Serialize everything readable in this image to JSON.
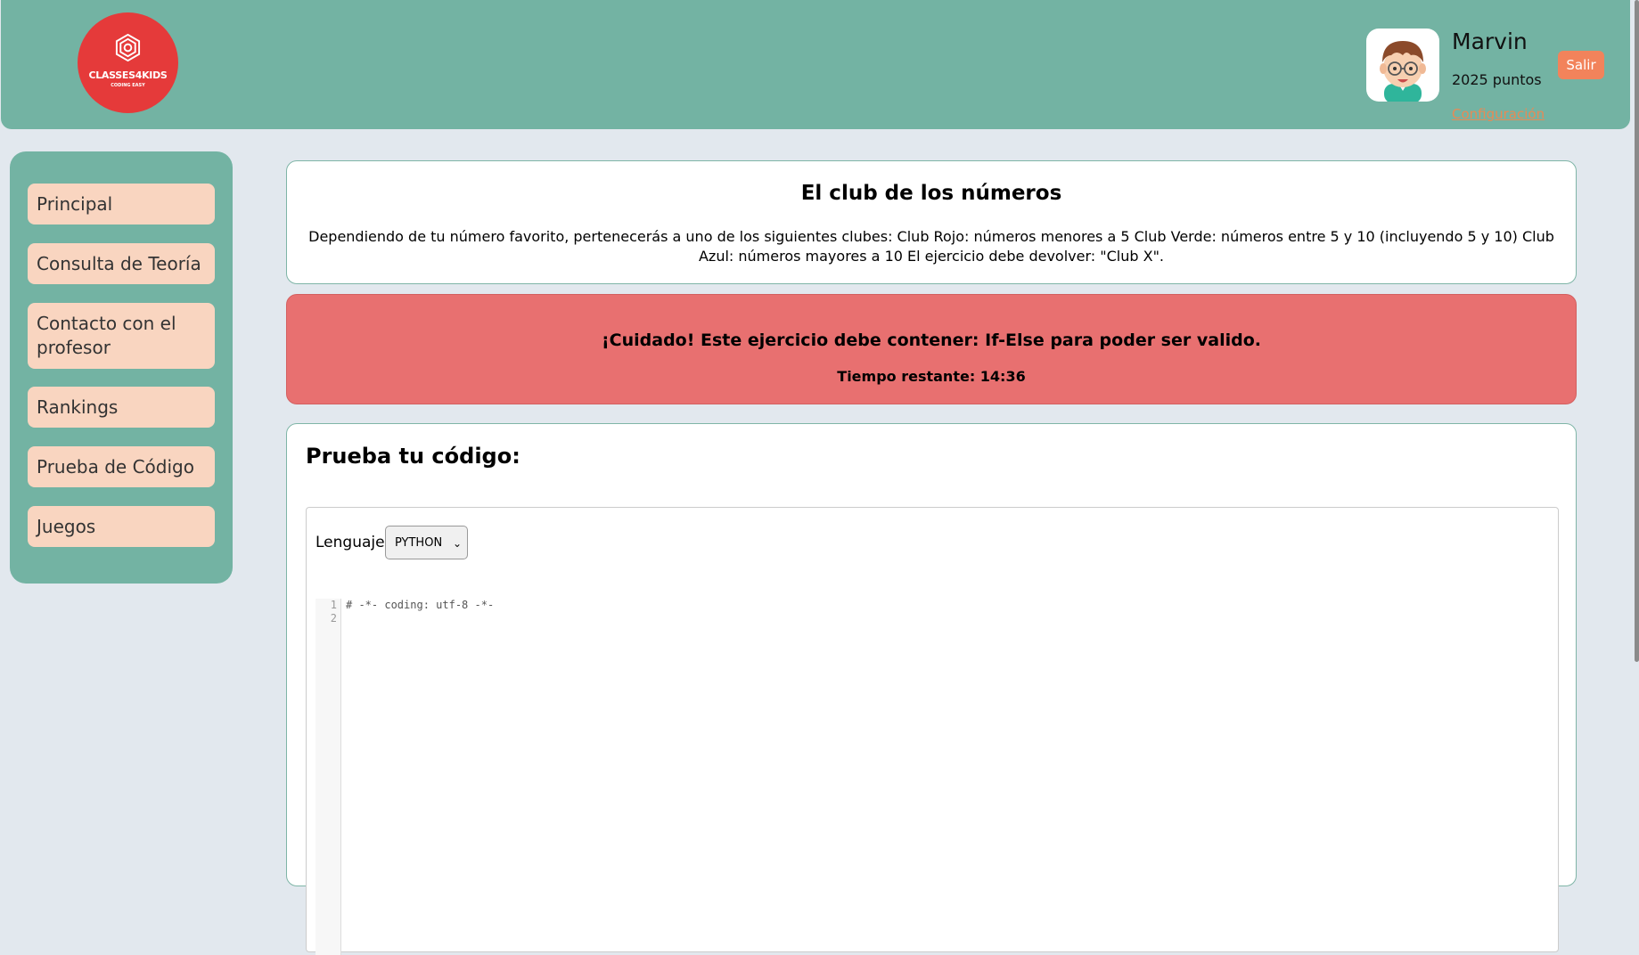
{
  "header": {
    "logo": {
      "text": "CLASSES4KIDS",
      "subtext": "CODING EASY",
      "icon": "hexagon-logo-icon"
    },
    "user": {
      "avatar_icon": "boy-avatar-icon",
      "name": "Marvin",
      "points": "2025 puntos",
      "config_link": "Configuración"
    },
    "logout_label": "Salir"
  },
  "sidebar": {
    "items": [
      {
        "label": "Principal"
      },
      {
        "label": "Consulta de Teoría"
      },
      {
        "label": "Contacto con el profesor"
      },
      {
        "label": "Rankings"
      },
      {
        "label": "Prueba de Código"
      },
      {
        "label": "Juegos"
      }
    ]
  },
  "exercise": {
    "title": "El club de los números",
    "description": "Dependiendo de tu número favorito, pertenecerás a uno de los siguientes clubes: Club Rojo: números menores a 5 Club Verde: números entre 5 y 10 (incluyendo 5 y 10) Club Azul: números mayores a 10 El ejercicio debe devolver: \"Club X\"."
  },
  "warning": {
    "message": "¡Cuidado! Este ejercicio debe contener: If-Else para poder ser valido.",
    "time_remaining": "Tiempo restante: 14:36"
  },
  "code_test": {
    "title": "Prueba tu código:",
    "language_label": "Lenguaje:",
    "language_selected": "PYTHON",
    "line_numbers": [
      "1",
      "2"
    ],
    "code": "# -*- coding: utf-8 -*-\n"
  },
  "colors": {
    "header_bg": "#73b3a3",
    "logo_bg": "#e53a3a",
    "nav_item_bg": "#f9d5c0",
    "warning_bg": "#e87070",
    "logout_bg": "#f2835b",
    "page_bg": "#e2e8ee"
  }
}
